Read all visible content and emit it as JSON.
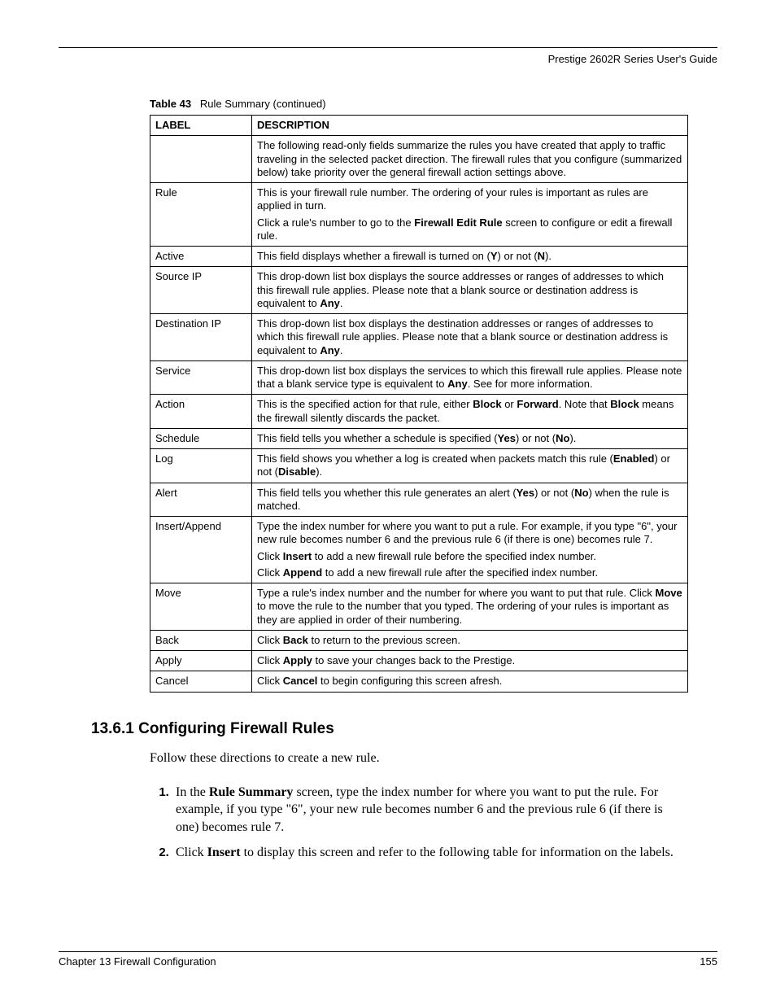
{
  "running_header": "Prestige 2602R Series User's Guide",
  "table_caption_label": "Table 43",
  "table_caption_title": "Rule Summary (continued)",
  "table_header": {
    "label": "LABEL",
    "description": "DESCRIPTION"
  },
  "rows": [
    {
      "label": "",
      "paras": [
        {
          "segments": [
            {
              "t": "The following read-only fields summarize the rules you have created that apply to traffic traveling in the selected packet direction. The firewall rules that you configure (summarized below) take priority over the general firewall action settings above."
            }
          ]
        }
      ]
    },
    {
      "label": "Rule",
      "paras": [
        {
          "segments": [
            {
              "t": "This is your firewall rule number. The ordering of your rules is important as rules are applied in turn."
            }
          ]
        },
        {
          "segments": [
            {
              "t": "Click a rule's number to go to the "
            },
            {
              "t": "Firewall Edit Rule",
              "b": true
            },
            {
              "t": " screen to configure or edit a firewall rule."
            }
          ]
        }
      ]
    },
    {
      "label": "Active",
      "paras": [
        {
          "segments": [
            {
              "t": "This field displays whether a firewall is turned on ("
            },
            {
              "t": "Y",
              "b": true
            },
            {
              "t": ") or not ("
            },
            {
              "t": "N",
              "b": true
            },
            {
              "t": ")."
            }
          ]
        }
      ]
    },
    {
      "label": "Source IP",
      "paras": [
        {
          "segments": [
            {
              "t": "This drop-down list box displays the source addresses or ranges of addresses to which this firewall rule applies. Please note that a blank source or destination address is equivalent to "
            },
            {
              "t": "Any",
              "b": true
            },
            {
              "t": "."
            }
          ]
        }
      ]
    },
    {
      "label": "Destination IP",
      "paras": [
        {
          "segments": [
            {
              "t": "This drop-down list box displays the destination addresses or ranges of addresses to which this firewall rule applies. Please note that a blank source or destination address is equivalent to "
            },
            {
              "t": "Any",
              "b": true
            },
            {
              "t": "."
            }
          ]
        }
      ]
    },
    {
      "label": "Service",
      "paras": [
        {
          "segments": [
            {
              "t": "This drop-down list box displays the services to which this firewall rule applies. Please note that a blank service type is equivalent to "
            },
            {
              "t": "Any",
              "b": true
            },
            {
              "t": ". See  for more information."
            }
          ]
        }
      ]
    },
    {
      "label": "Action",
      "paras": [
        {
          "segments": [
            {
              "t": "This is the specified action for that rule, either "
            },
            {
              "t": "Block",
              "b": true
            },
            {
              "t": " or "
            },
            {
              "t": "Forward",
              "b": true
            },
            {
              "t": ". Note that "
            },
            {
              "t": "Block",
              "b": true
            },
            {
              "t": " means the firewall silently discards the packet."
            }
          ]
        }
      ]
    },
    {
      "label": "Schedule",
      "paras": [
        {
          "segments": [
            {
              "t": "This field tells you whether a schedule is specified ("
            },
            {
              "t": "Yes",
              "b": true
            },
            {
              "t": ") or not ("
            },
            {
              "t": "No",
              "b": true
            },
            {
              "t": ")."
            }
          ]
        }
      ]
    },
    {
      "label": "Log",
      "paras": [
        {
          "segments": [
            {
              "t": "This field shows you whether a log is created when packets match this rule ("
            },
            {
              "t": "Enabled",
              "b": true
            },
            {
              "t": ") or not ("
            },
            {
              "t": "Disable",
              "b": true
            },
            {
              "t": ")."
            }
          ]
        }
      ]
    },
    {
      "label": "Alert",
      "paras": [
        {
          "segments": [
            {
              "t": "This field tells you whether this rule generates an alert ("
            },
            {
              "t": "Yes",
              "b": true
            },
            {
              "t": ") or not ("
            },
            {
              "t": "No",
              "b": true
            },
            {
              "t": ") when the rule is matched."
            }
          ]
        }
      ]
    },
    {
      "label": "Insert/Append",
      "paras": [
        {
          "segments": [
            {
              "t": "Type the index number for where you want to put a rule. For example, if you type \"6\", your new rule becomes number 6 and the previous rule 6 (if there is one) becomes rule 7."
            }
          ]
        },
        {
          "segments": [
            {
              "t": "Click "
            },
            {
              "t": "Insert",
              "b": true
            },
            {
              "t": " to add a new firewall rule before the specified index number."
            }
          ]
        },
        {
          "segments": [
            {
              "t": "Click "
            },
            {
              "t": "Append",
              "b": true
            },
            {
              "t": " to add a new firewall rule after the specified index number."
            }
          ]
        }
      ]
    },
    {
      "label": "Move",
      "paras": [
        {
          "segments": [
            {
              "t": "Type a rule's index number and the number for where you want to put that rule. Click "
            },
            {
              "t": "Move",
              "b": true
            },
            {
              "t": " to move the rule to the number that you typed. The ordering of your rules is important as they are applied in order of their numbering."
            }
          ]
        }
      ]
    },
    {
      "label": "Back",
      "paras": [
        {
          "segments": [
            {
              "t": "Click "
            },
            {
              "t": "Back",
              "b": true
            },
            {
              "t": " to return to the previous screen."
            }
          ]
        }
      ]
    },
    {
      "label": "Apply",
      "paras": [
        {
          "segments": [
            {
              "t": "Click "
            },
            {
              "t": "Apply",
              "b": true
            },
            {
              "t": " to save your changes back to the Prestige."
            }
          ]
        }
      ]
    },
    {
      "label": "Cancel",
      "paras": [
        {
          "segments": [
            {
              "t": "Click "
            },
            {
              "t": "Cancel",
              "b": true
            },
            {
              "t": " to begin configuring this screen afresh."
            }
          ]
        }
      ]
    }
  ],
  "section_heading": "13.6.1  Configuring Firewall Rules",
  "intro_text": "Follow these directions to create a new rule.",
  "steps": [
    {
      "segments": [
        {
          "t": "In the "
        },
        {
          "t": "Rule Summary",
          "b": true
        },
        {
          "t": " screen, type the index number for where you want to put the rule. For example, if you type \"6\", your new rule becomes number 6 and the previous rule 6 (if there is one) becomes rule 7."
        }
      ]
    },
    {
      "segments": [
        {
          "t": "Click "
        },
        {
          "t": "Insert",
          "b": true
        },
        {
          "t": " to display this screen and refer to the following table for information on the labels."
        }
      ]
    }
  ],
  "footer_left": "Chapter 13 Firewall Configuration",
  "footer_right": "155"
}
